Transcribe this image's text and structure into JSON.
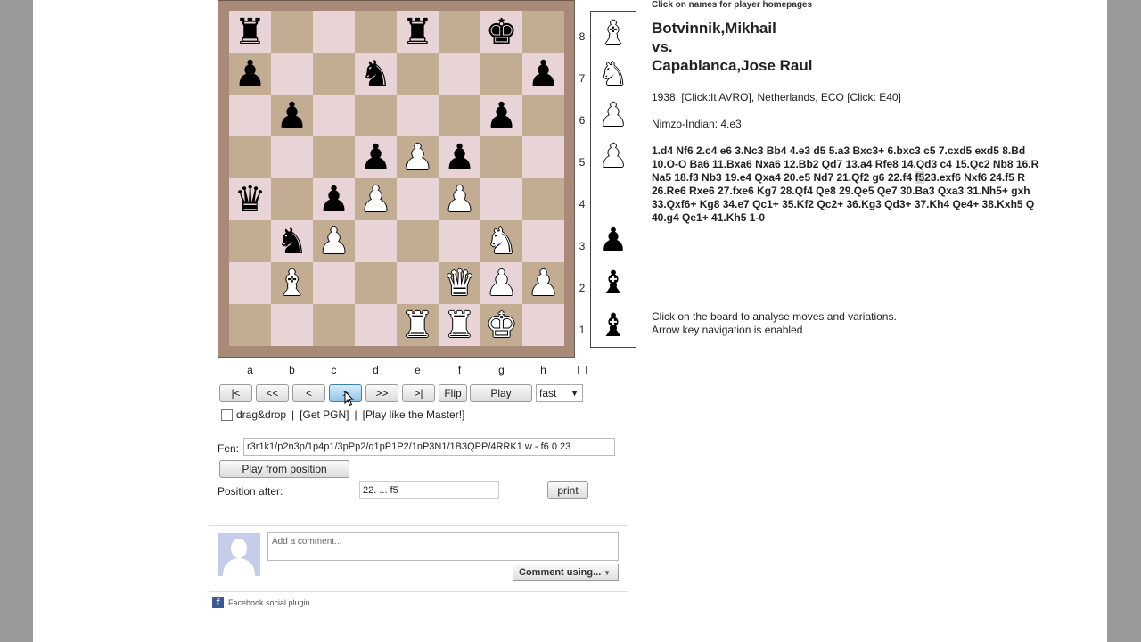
{
  "header": {
    "hint": "Click on names for player homepages"
  },
  "players": {
    "white": "Botvinnik,Mikhail",
    "vs": "vs.",
    "black": "Capablanca,Jose Raul"
  },
  "game": {
    "info": "1938,  [Click:It AVRO],  Netherlands,  ECO [Click: E40]",
    "opening": "Nimzo-Indian: 4.e3",
    "moves_lines": [
      "1.d4 Nf6 2.c4 e6 3.Nc3 Bb4 4.e3 d5 5.a3 Bxc3+ 6.bxc3 c5 7.cxd5 exd5 8.Bd",
      "10.O-O Ba6 11.Bxa6 Nxa6 12.Bb2 Qd7 13.a4 Rfe8 14.Qd3 c4 15.Qc2 Nb8 16.R",
      "Na5 18.f3 Nb3 19.e4 Qxa4 20.e5 Nd7 21.Qf2 g6 22.f4 ",
      "26.Re6 Rxe6 27.fxe6 Kg7 28.Qf4 Qe8 29.Qe5 Qe7 30.Ba3 Qxa3 31.Nh5+ gxh",
      "33.Qxf6+ Kg8 34.e7 Qc1+ 35.Kf2 Qc2+ 36.Kg3 Qd3+ 37.Kh4 Qe4+ 38.Kxh5 Q",
      "40.g4 Qe1+ 41.Kh5 1-0"
    ],
    "current_move": "f5",
    "line3_tail": "23.exf6 Nxf6 24.f5 R",
    "help_lines": [
      "Click on the board to analyse moves and variations.",
      "Arrow key navigation is enabled"
    ]
  },
  "board": {
    "files": [
      "a",
      "b",
      "c",
      "d",
      "e",
      "f",
      "g",
      "h"
    ],
    "ranks": [
      "8",
      "7",
      "6",
      "5",
      "4",
      "3",
      "2",
      "1"
    ],
    "position": [
      [
        "br",
        "",
        "",
        "",
        "br",
        "",
        "bk",
        ""
      ],
      [
        "bp",
        "",
        "",
        "bn",
        "",
        "",
        "",
        "bp"
      ],
      [
        "",
        "bp",
        "",
        "",
        "",
        "",
        "bp",
        ""
      ],
      [
        "",
        "",
        "",
        "bp",
        "wp",
        "bp",
        "",
        ""
      ],
      [
        "bq",
        "",
        "bp",
        "wp",
        "",
        "wp",
        "",
        ""
      ],
      [
        "",
        "bn",
        "wp",
        "",
        "",
        "",
        "wn",
        ""
      ],
      [
        "",
        "wb",
        "",
        "",
        "",
        "wq",
        "wp",
        "wp"
      ],
      [
        "",
        "",
        "",
        "",
        "wr",
        "wr",
        "wk",
        ""
      ]
    ],
    "captured": [
      {
        "piece": "wb"
      },
      {
        "piece": "wn"
      },
      {
        "piece": "wp"
      },
      {
        "piece": "wp"
      },
      {
        "piece": "bp"
      },
      {
        "piece": "bb"
      },
      {
        "piece": "bb"
      }
    ]
  },
  "controls": {
    "first": "|<",
    "back5": "<<",
    "back": "<",
    "fwd": ">",
    "fwd5": ">>",
    "last": ">|",
    "flip": "Flip",
    "play": "Play",
    "speed": "fast",
    "dragdrop": "drag&drop",
    "get_pgn": "[Get PGN]",
    "play_master": "[Play like the Master!]"
  },
  "fen": {
    "label": "Fen:",
    "value": "r3r1k1/p2n3p/1p4p1/3pPp2/q1pP1P2/1nP3N1/1B3QPP/4RRK1 w - f6 0 23"
  },
  "play_from_position": "Play from position",
  "position_after": {
    "label": "Position after:",
    "value": "22. ... f5"
  },
  "print": "print",
  "comments": {
    "placeholder": "Add a comment...",
    "comment_using": "Comment using...",
    "plugin": "Facebook social plugin"
  }
}
